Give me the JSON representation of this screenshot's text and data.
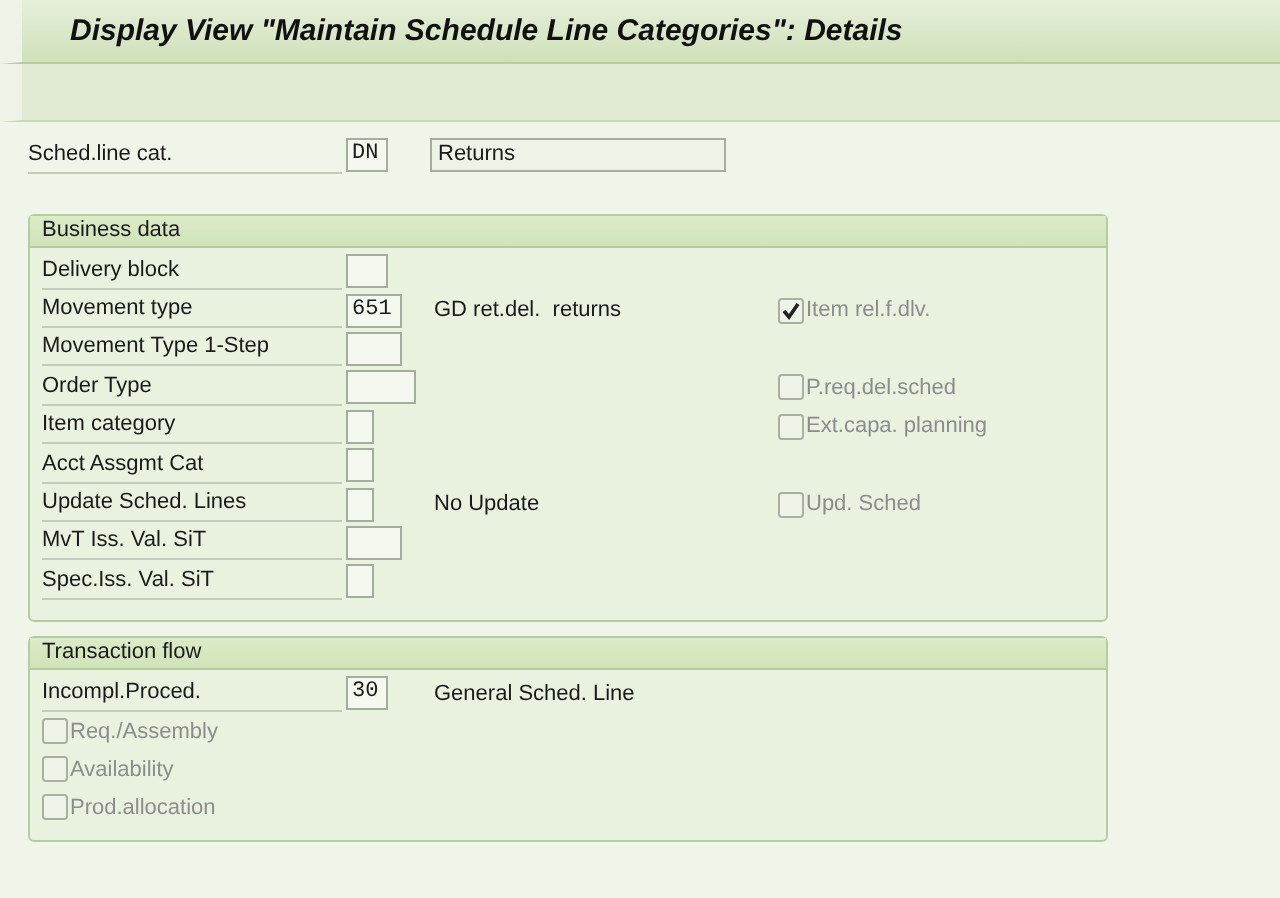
{
  "window": {
    "title": "Display View \"Maintain Schedule Line Categories\": Details"
  },
  "header_field": {
    "label": "Sched.line cat.",
    "value": "DN",
    "kind": "s",
    "description": "Returns"
  },
  "business_data": {
    "title": "Business data",
    "rows": [
      {
        "label": "Delivery block",
        "kind": "s"
      },
      {
        "label": "Movement type",
        "value": "651",
        "kind": "m",
        "description": "GD ret.del.  returns",
        "checkbox": {
          "label": "Item rel.f.dlv.",
          "checked": true,
          "disabled": true
        }
      },
      {
        "label": "Movement Type 1-Step",
        "kind": "m"
      },
      {
        "label": "Order Type",
        "kind": "l",
        "checkbox": {
          "label": "P.req.del.sched",
          "checked": false,
          "disabled": true
        }
      },
      {
        "label": "Item category",
        "kind": "xs",
        "checkbox": {
          "label": "Ext.capa. planning",
          "checked": false,
          "disabled": true
        }
      },
      {
        "label": "Acct Assgmt Cat",
        "kind": "xs"
      },
      {
        "label": "Update Sched. Lines",
        "kind": "xs",
        "description": "No Update",
        "checkbox": {
          "label": "Upd. Sched",
          "checked": false,
          "disabled": true
        }
      },
      {
        "label": "MvT Iss. Val. SiT",
        "kind": "m"
      },
      {
        "label": "Spec.Iss. Val. SiT",
        "kind": "xs"
      }
    ]
  },
  "transaction_flow": {
    "title": "Transaction flow",
    "rows": [
      {
        "label": "Incompl.Proced.",
        "value": "30",
        "kind": "s",
        "description": "General Sched. Line"
      }
    ],
    "checkboxes": [
      {
        "label": "Req./Assembly",
        "checked": false,
        "disabled": true
      },
      {
        "label": "Availability",
        "checked": false,
        "disabled": true
      },
      {
        "label": "Prod.allocation",
        "checked": false,
        "disabled": true
      }
    ]
  }
}
